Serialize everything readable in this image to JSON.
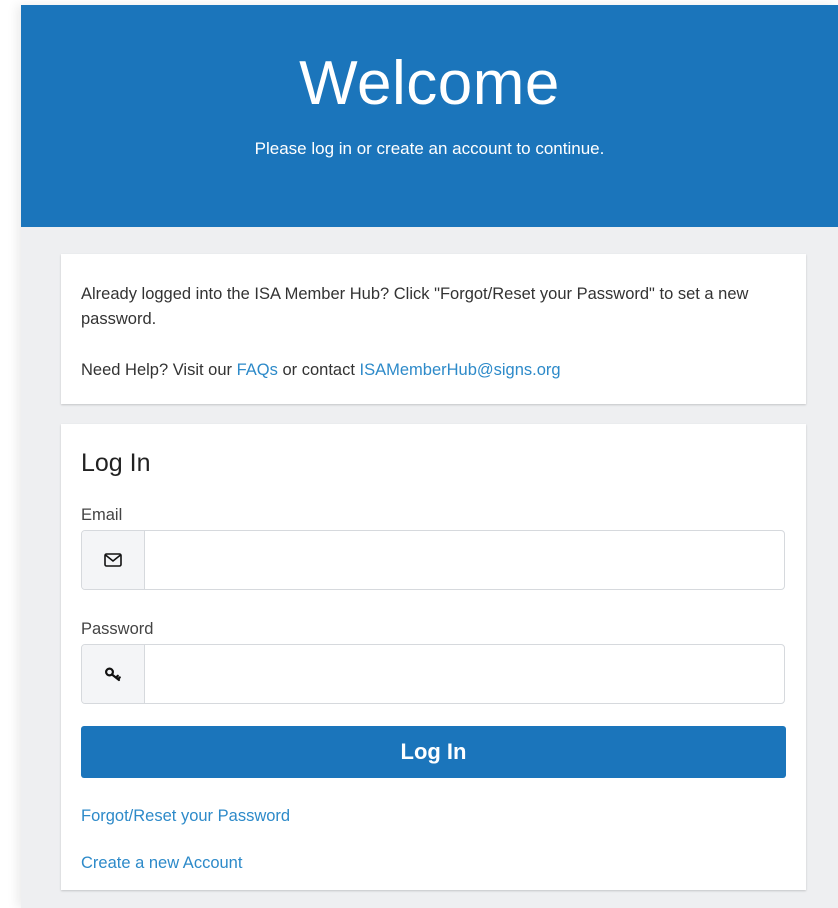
{
  "header": {
    "title": "Welcome",
    "subtitle": "Please log in or create an account to continue."
  },
  "notice": {
    "line1": "Already logged into the ISA Member Hub? Click \"Forgot/Reset your Password\" to set a new password.",
    "help_prefix": "Need Help? Visit our ",
    "faqs_link": "FAQs",
    "contact_text": " or contact ",
    "email_link": "ISAMemberHub@signs.org"
  },
  "login": {
    "title": "Log In",
    "email_label": "Email",
    "email_value": "",
    "email_icon": "envelope-icon",
    "password_label": "Password",
    "password_value": "",
    "password_icon": "key-icon",
    "submit_label": "Log In",
    "forgot_link": "Forgot/Reset your Password",
    "create_link": "Create a new Account"
  },
  "colors": {
    "brand_blue": "#1b75bb",
    "link_blue": "#2d8ac9",
    "page_bg": "#eeeff1"
  }
}
